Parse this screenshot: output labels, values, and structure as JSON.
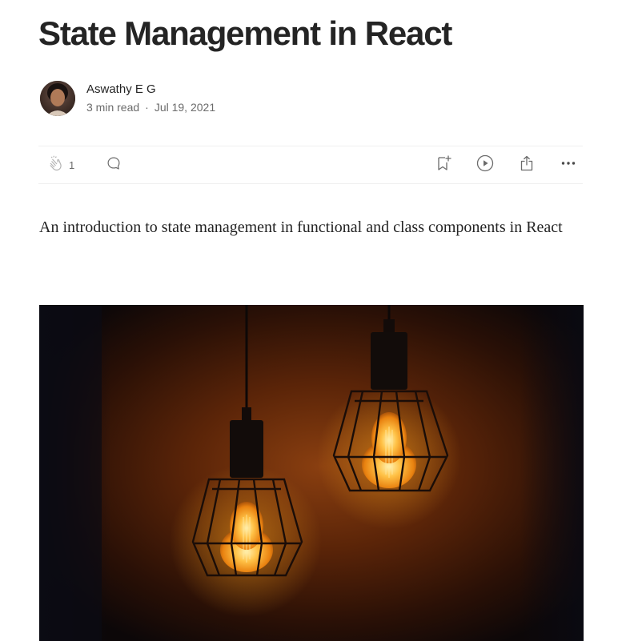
{
  "article": {
    "title": "State Management in React",
    "subtitle": "An introduction to state management in functional and class components in React"
  },
  "author": {
    "name": "Aswathy E G",
    "read_time": "3 min read",
    "separator": "·",
    "date": "Jul 19, 2021"
  },
  "actions": {
    "clap_count": "1",
    "icons": [
      "clap-icon",
      "response-icon",
      "bookmark-icon",
      "play-icon",
      "share-icon",
      "more-icon"
    ]
  },
  "colors": {
    "text": "#242424",
    "muted": "#6b6b6b",
    "divider": "#f0f0f0",
    "bulb_glow": "#f7a21b"
  }
}
